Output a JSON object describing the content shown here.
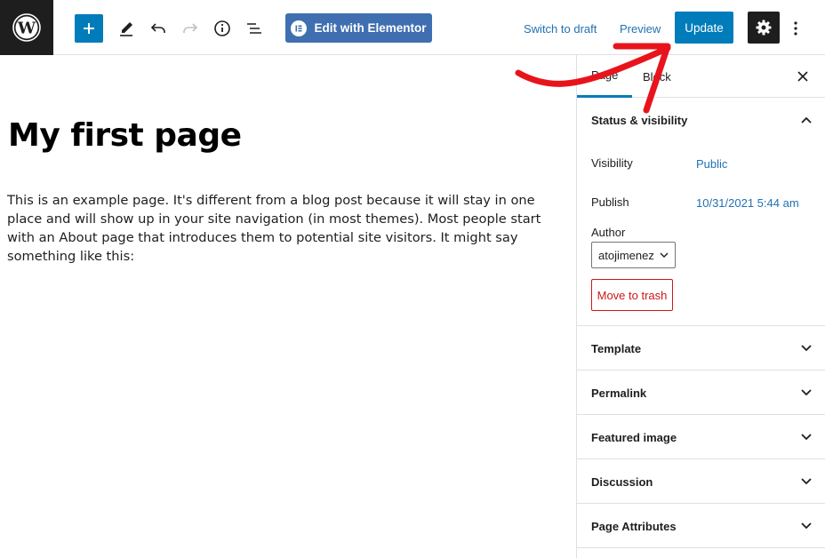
{
  "toolbar": {
    "edit_elementor_label": "Edit with Elementor",
    "switch_draft_label": "Switch to draft",
    "preview_label": "Preview",
    "update_label": "Update"
  },
  "editor": {
    "title": "My first page",
    "body": "This is an example page. It's different from a blog post because it will stay in one place and will show up in your site navigation (in most themes). Most people start with an About page that introduces them to potential site visitors. It might say something like this:"
  },
  "sidebar": {
    "tabs": [
      {
        "label": "Page"
      },
      {
        "label": "Block"
      }
    ],
    "status": {
      "heading": "Status & visibility",
      "visibility_label": "Visibility",
      "visibility_value": "Public",
      "publish_label": "Publish",
      "publish_value": "10/31/2021 5:44 am",
      "author_label": "Author",
      "author_value": "atojimenez",
      "trash_label": "Move to trash"
    },
    "sections": [
      {
        "label": "Template"
      },
      {
        "label": "Permalink"
      },
      {
        "label": "Featured image"
      },
      {
        "label": "Discussion"
      },
      {
        "label": "Page Attributes"
      }
    ]
  },
  "colors": {
    "accent": "#007cba",
    "elementor": "#3f6fb0",
    "annotation_arrow": "#e8141c",
    "danger": "#cc1818"
  }
}
